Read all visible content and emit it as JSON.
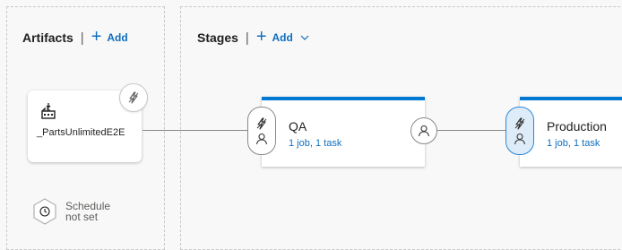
{
  "artifacts": {
    "title": "Artifacts",
    "separator": "|",
    "add_label": "Add",
    "items": [
      {
        "name": "_PartsUnlimitedE2E",
        "icon": "build-icon",
        "trigger_icon": "lightning-icon"
      }
    ],
    "schedule": {
      "line1": "Schedule",
      "line2": "not set",
      "icon": "clock-icon"
    }
  },
  "stages": {
    "title": "Stages",
    "separator": "|",
    "add_label": "Add",
    "add_menu_icon": "chevron-down-icon",
    "items": [
      {
        "name": "QA",
        "summary": "1 job, 1 task"
      },
      {
        "name": "Production",
        "summary": "1 job, 1 task"
      }
    ]
  },
  "colors": {
    "accent": "#0078d4",
    "link": "#106ebe",
    "background": "#f8f8f8",
    "selected_pill": "#deecf9"
  }
}
